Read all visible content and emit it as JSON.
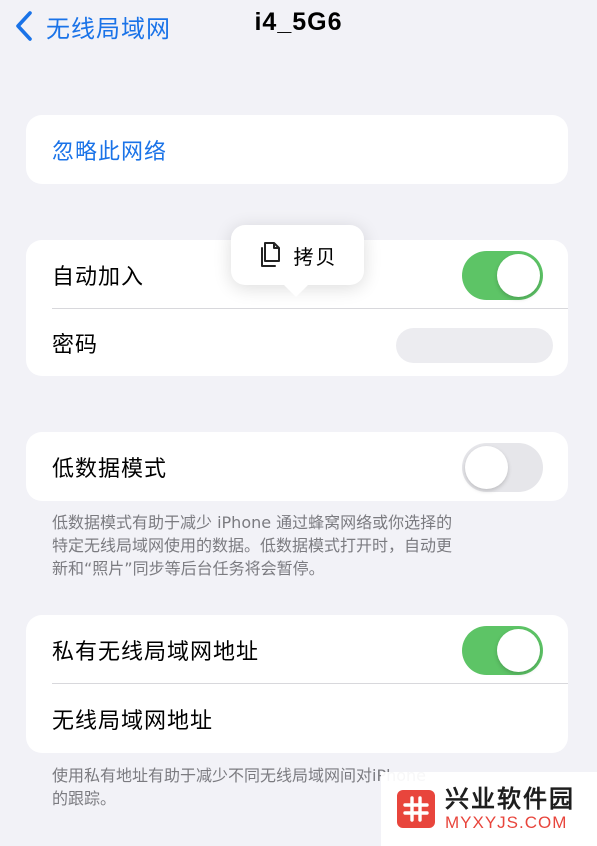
{
  "nav": {
    "back_label": "无线局域网",
    "title": "i4_5G6"
  },
  "forget": {
    "label": "忽略此网络"
  },
  "join_group": {
    "auto_join_label": "自动加入",
    "auto_join_on": true,
    "password_label": "密码"
  },
  "copy_popup": {
    "label": "拷贝"
  },
  "low_data": {
    "label": "低数据模式",
    "on": false,
    "footnote_lines": [
      "低数据模式有助于减少 iPhone 通过蜂窝网络或你选择的",
      "特定无线局域网使用的数据。低数据模式打开时，自动更",
      "新和“照片”同步等后台任务将会暂停。"
    ]
  },
  "private_address": {
    "label": "私有无线局域网地址",
    "on": true,
    "address_label": "无线局域网地址",
    "footnote_lines": [
      "使用私有地址有助于减少不同无线局域网间对iPhone",
      "的跟踪。"
    ]
  },
  "watermark": {
    "title": "兴业软件园",
    "subtitle": "MYXYJS.COM"
  },
  "colors": {
    "link": "#1a73e8",
    "toggle_on": "#5dc466",
    "toggle_off": "#e6e6ea",
    "background": "#f2f2f7"
  }
}
